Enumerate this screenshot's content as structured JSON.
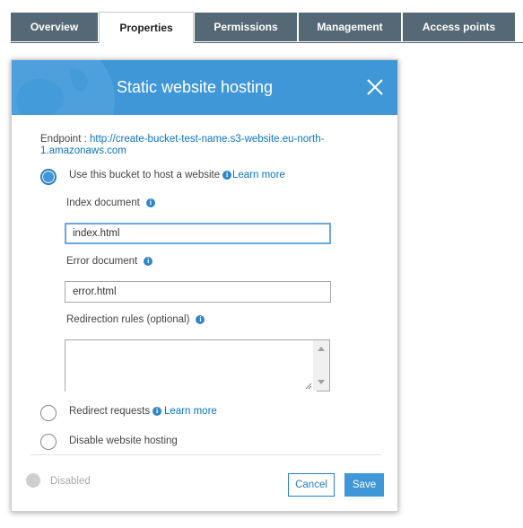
{
  "tabs": [
    {
      "label": "Overview",
      "active": false
    },
    {
      "label": "Properties",
      "active": true
    },
    {
      "label": "Permissions",
      "active": false
    },
    {
      "label": "Management",
      "active": false
    },
    {
      "label": "Access points",
      "active": false
    }
  ],
  "dialog": {
    "title": "Static website hosting",
    "endpoint_label": "Endpoint :",
    "endpoint_url": "http://create-bucket-test-name.s3-website.eu-north-1.amazonaws.com",
    "options": {
      "host": {
        "label": "Use this bucket to host a website",
        "learn_more": "Learn more",
        "selected": true
      },
      "redirect": {
        "label": "Redirect requests",
        "learn_more": "Learn more",
        "selected": false
      },
      "disable": {
        "label": "Disable website hosting",
        "selected": false
      }
    },
    "fields": {
      "index": {
        "label": "Index document",
        "value": "index.html"
      },
      "error": {
        "label": "Error document",
        "value": "error.html"
      },
      "redirection": {
        "label": "Redirection rules (optional)",
        "value": ""
      }
    },
    "status": "Disabled",
    "buttons": {
      "cancel": "Cancel",
      "save": "Save"
    }
  },
  "colors": {
    "header": "#3f97d8",
    "tab_bg": "#546875",
    "link": "#0b74c4",
    "save": "#3f97d8"
  },
  "icons": [
    "close-icon",
    "info-icon",
    "globe-graphic",
    "resize-grip-icon"
  ]
}
